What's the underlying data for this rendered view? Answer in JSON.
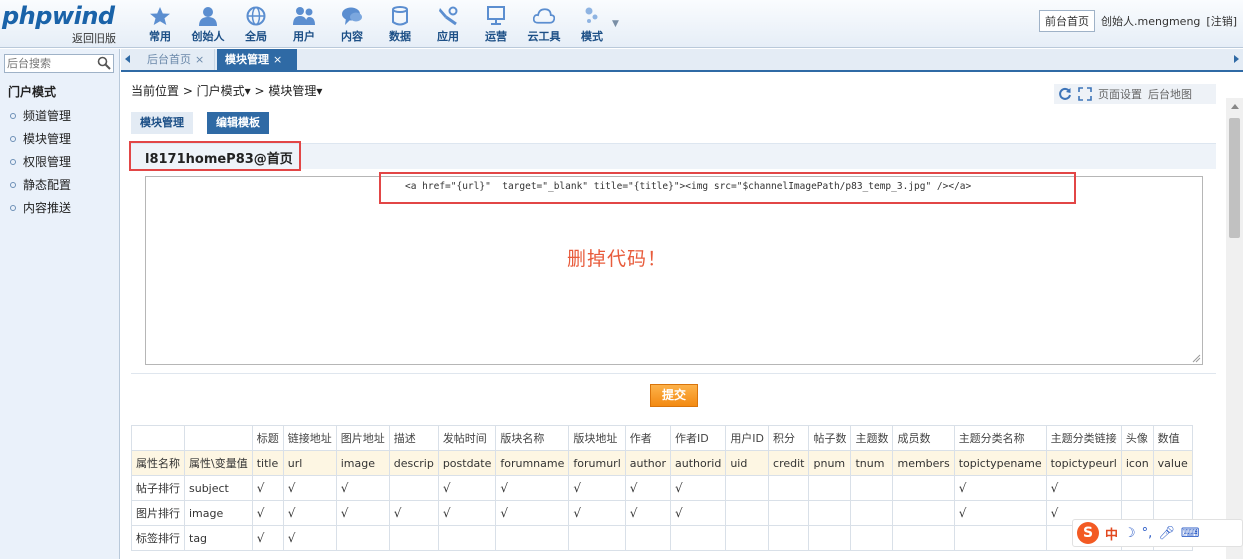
{
  "header": {
    "logo": "phpwind",
    "logo_sub": "返回旧版",
    "nav": [
      {
        "label": "常用",
        "icon": "star-icon"
      },
      {
        "label": "创始人",
        "icon": "user-icon"
      },
      {
        "label": "全局",
        "icon": "globe-icon"
      },
      {
        "label": "用户",
        "icon": "users-icon"
      },
      {
        "label": "内容",
        "icon": "chat-icon"
      },
      {
        "label": "数据",
        "icon": "database-icon"
      },
      {
        "label": "应用",
        "icon": "tools-icon"
      },
      {
        "label": "运营",
        "icon": "monitor-icon"
      },
      {
        "label": "云工具",
        "icon": "cloud-icon"
      },
      {
        "label": "模式",
        "icon": "mode-icon"
      }
    ],
    "home_button": "前台首页",
    "user": "创始人.mengmeng",
    "logout": "[注销]"
  },
  "sidebar": {
    "search_placeholder": "后台搜索",
    "title": "门户模式",
    "items": [
      "频道管理",
      "模块管理",
      "权限管理",
      "静态配置",
      "内容推送"
    ]
  },
  "tabs": [
    {
      "label": "后台首页",
      "close": "×"
    },
    {
      "label": "模块管理",
      "close": "×"
    }
  ],
  "breadcrumb": "当前位置 > 门户模式▾ > 模块管理▾",
  "tools": {
    "page_settings": "页面设置",
    "backend_map": "后台地图"
  },
  "subtabs": [
    "模块管理",
    "编辑模板"
  ],
  "section_title": "l8171homeP83@首页",
  "code_line": "<a href=\"{url}\"  target=\"_blank\" title=\"{title}\"><img src=\"$channelImagePath/p83_temp_3.jpg\" /></a>",
  "annotation": "删掉代码！",
  "submit": "提交",
  "table": {
    "labels_row": [
      "",
      "",
      "标题",
      "链接地址",
      "图片地址",
      "描述",
      "发帖时间",
      "版块名称",
      "版块地址",
      "作者",
      "作者ID",
      "用户ID",
      "积分",
      "帖子数",
      "主题数",
      "成员数",
      "主题分类名称",
      "主题分类链接",
      "头像",
      "数值"
    ],
    "vars_row": [
      "属性名称",
      "属性\\变量值",
      "title",
      "url",
      "image",
      "descrip",
      "postdate",
      "forumname",
      "forumurl",
      "author",
      "authorid",
      "uid",
      "credit",
      "pnum",
      "tnum",
      "members",
      "topictypename",
      "topictypeurl",
      "icon",
      "value"
    ],
    "rows": [
      [
        "帖子排行",
        "subject",
        "√",
        "√",
        "√",
        "",
        "√",
        "√",
        "√",
        "√",
        "√",
        "",
        "",
        "",
        "",
        "",
        "√",
        "√",
        "",
        ""
      ],
      [
        "图片排行",
        "image",
        "√",
        "√",
        "√",
        "√",
        "√",
        "√",
        "√",
        "√",
        "√",
        "",
        "",
        "",
        "",
        "",
        "√",
        "√",
        "",
        ""
      ],
      [
        "标签排行",
        "tag",
        "√",
        "√",
        "",
        "",
        "",
        "",
        "",
        "",
        "",
        "",
        "",
        "",
        "",
        "",
        "",
        "",
        "",
        ""
      ]
    ]
  },
  "ime": {
    "logo": "S",
    "mode": "中"
  }
}
